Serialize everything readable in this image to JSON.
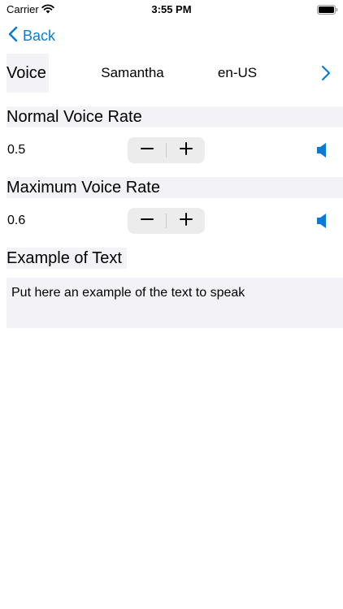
{
  "status_bar": {
    "carrier": "Carrier",
    "time": "3:55 PM"
  },
  "nav": {
    "back_label": "Back"
  },
  "voice": {
    "label": "Voice",
    "name": "Samantha",
    "language": "en-US"
  },
  "normal_rate": {
    "title": "Normal Voice Rate",
    "value": "0.5"
  },
  "max_rate": {
    "title": "Maximum Voice Rate",
    "value": "0.6"
  },
  "example": {
    "title": "Example of Text",
    "text": "Put here an example of the text to speak"
  },
  "colors": {
    "accent": "#0a7bd4",
    "section_bg": "#f2f2f7",
    "stepper_bg": "#ececec"
  },
  "icons": [
    "wifi-icon",
    "battery-icon",
    "chevron-left-icon",
    "chevron-right-icon",
    "minus-icon",
    "plus-icon",
    "speaker-icon"
  ]
}
